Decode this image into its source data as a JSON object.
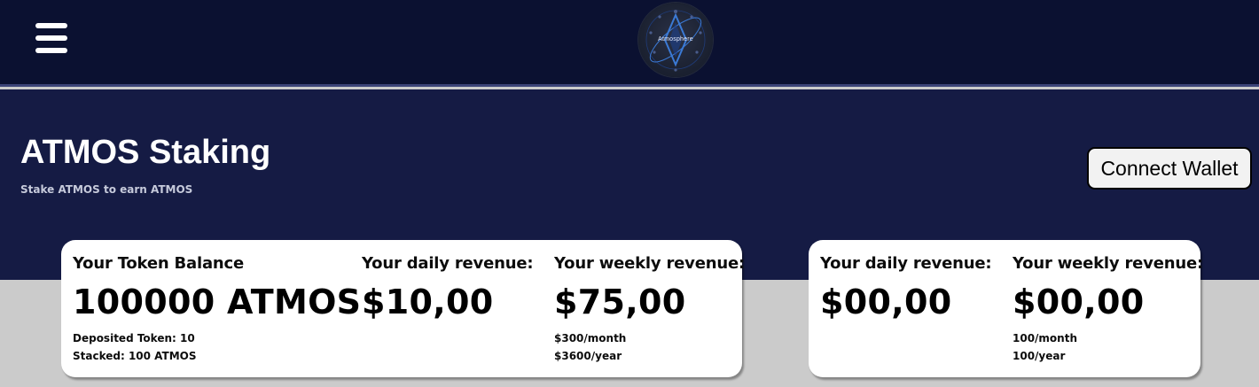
{
  "header": {
    "menu_icon": "hamburger-menu-icon",
    "logo": {
      "text": "Atmosphere",
      "icon": "diamond-orbit-logo"
    }
  },
  "hero": {
    "title": "ATMOS Staking",
    "subtitle": "Stake ATMOS to earn ATMOS",
    "connect_button": "Connect Wallet"
  },
  "cards": [
    {
      "columns": [
        {
          "label": "Your Token Balance",
          "value": "100000 ATMOS",
          "notes": [
            "Deposited Token: 10",
            "Stacked: 100 ATMOS"
          ]
        },
        {
          "label": "Your daily revenue:",
          "value": "$10,00",
          "notes": []
        },
        {
          "label": "Your weekly revenue:",
          "value": "$75,00",
          "notes": [
            "$300/month",
            "$3600/year"
          ]
        }
      ]
    },
    {
      "columns": [
        {
          "label": "Your daily revenue:",
          "value": "$00,00",
          "notes": []
        },
        {
          "label": "Your weekly revenue:",
          "value": "$00,00",
          "notes": [
            "100/month",
            "100/year"
          ]
        }
      ]
    }
  ],
  "colors": {
    "topbar": "#0b1131",
    "hero": "#151b44",
    "page_background": "#cbcbcb",
    "card": "#ffffff",
    "logo_accent": "#3b7ad6"
  }
}
